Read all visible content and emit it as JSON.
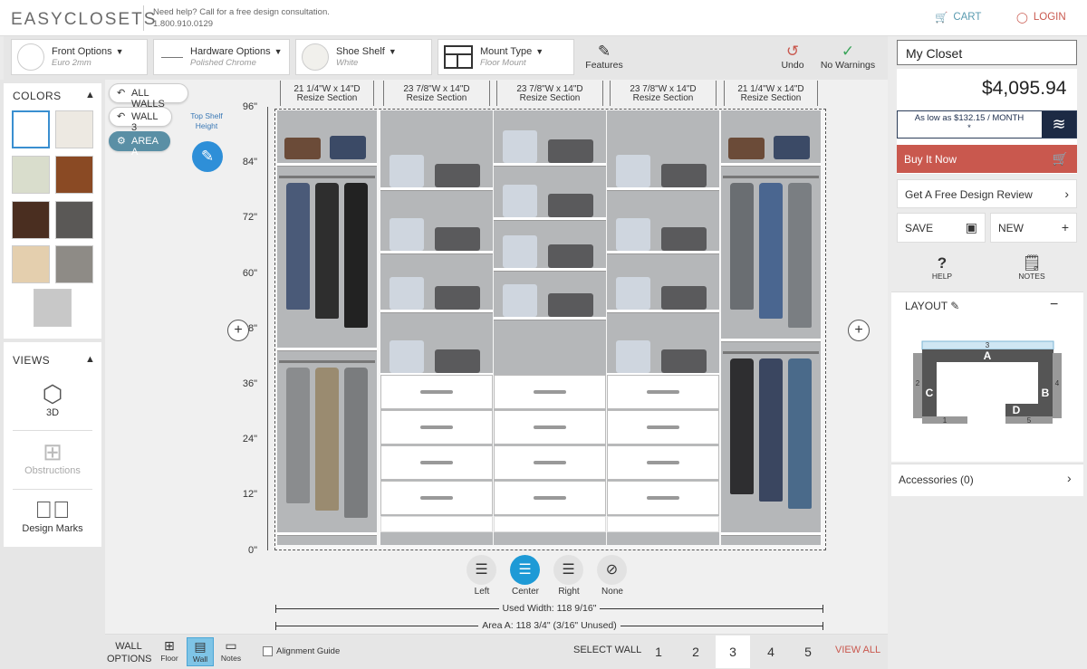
{
  "header": {
    "logo": "EASYCLOSETS",
    "help_line1": "Need help? Call for a free design consultation.",
    "help_line2": "1.800.910.0129",
    "cart_label": "CART",
    "login_label": "LOGIN"
  },
  "options": {
    "front": {
      "label": "Front Options",
      "value": "Euro 2mm"
    },
    "hardware": {
      "label": "Hardware Options",
      "value": "Polished Chrome"
    },
    "shoe": {
      "label": "Shoe Shelf",
      "value": "White"
    },
    "mount": {
      "label": "Mount Type",
      "value": "Floor Mount"
    },
    "features_label": "Features",
    "undo_label": "Undo",
    "warnings_label": "No Warnings"
  },
  "right": {
    "closet_name": "My Closet",
    "price": "$4,095.94",
    "financing": "As low as $132.15 / MONTH",
    "financing_note": "*",
    "buy_label": "Buy It Now",
    "review_label": "Get A Free Design Review",
    "save_label": "SAVE",
    "new_label": "NEW",
    "help_label": "HELP",
    "notes_label": "NOTES",
    "layout_title": "LAYOUT",
    "accessories_label": "Accessories (0)",
    "layout_labels": {
      "a": "A",
      "b": "B",
      "c": "C",
      "d": "D",
      "n1": "1",
      "n2": "2",
      "n3": "3",
      "n4": "4",
      "n5": "5"
    }
  },
  "left": {
    "colors_title": "COLORS",
    "views_title": "VIEWS",
    "views": [
      {
        "label": "3D",
        "icon": "cube-icon"
      },
      {
        "label": "Obstructions",
        "icon": "window-icon"
      },
      {
        "label": "Design Marks",
        "icon": "checkmark-circle-icon"
      }
    ],
    "swatches": [
      "#ffffff",
      "#ede9e2",
      "#d9ddcc",
      "#8a4a24",
      "#4a2e20",
      "#5a5856",
      "#e4cfae",
      "#8e8b86",
      "#c8c8c8"
    ]
  },
  "canvas": {
    "pills": {
      "all_walls": "ALL WALLS",
      "wall3": "WALL 3",
      "area_a": "AREA A"
    },
    "top_shelf_label": "Top Shelf Height",
    "y_labels": [
      "96\"",
      "84\"",
      "72\"",
      "60\"",
      "48\"",
      "36\"",
      "24\"",
      "12\"",
      "0\""
    ],
    "sections": [
      {
        "dim": "21 1/4\"W x 14\"D",
        "label": "Resize Section"
      },
      {
        "dim": "23 7/8\"W x 14\"D",
        "label": "Resize Section"
      },
      {
        "dim": "23 7/8\"W x 14\"D",
        "label": "Resize Section"
      },
      {
        "dim": "23 7/8\"W x 14\"D",
        "label": "Resize Section"
      },
      {
        "dim": "21 1/4\"W x 14\"D",
        "label": "Resize Section"
      }
    ],
    "align": [
      {
        "label": "Left",
        "icon": "align-left-icon"
      },
      {
        "label": "Center",
        "icon": "align-center-icon"
      },
      {
        "label": "Right",
        "icon": "align-right-icon"
      },
      {
        "label": "None",
        "icon": "none-icon"
      }
    ],
    "used_width": "Used Width: 118 9/16\"",
    "area_width": "Area A: 118 3/4\" (3/16\" Unused)"
  },
  "bottom": {
    "wall_options_l1": "WALL",
    "wall_options_l2": "OPTIONS",
    "floor_label": "Floor",
    "wall_label": "Wall",
    "notes_label": "Notes",
    "alignment_guide": "Alignment Guide",
    "select_wall": "SELECT WALL",
    "walls": [
      "1",
      "2",
      "3",
      "4",
      "5"
    ],
    "view_all": "VIEW ALL"
  },
  "colors": {
    "accent": "#c9584e",
    "blue": "#1e9ad6",
    "link": "#5a9bb0"
  }
}
